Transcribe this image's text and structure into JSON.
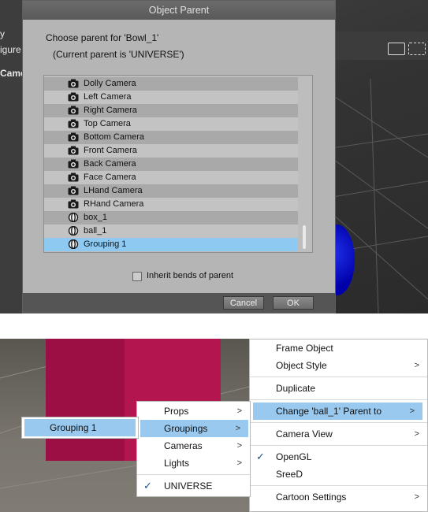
{
  "top_scene": {
    "left_labels": [
      "y",
      "igure",
      "Came"
    ]
  },
  "dialog": {
    "title": "Object Parent",
    "prompt": "Choose parent for 'Bowl_1'",
    "current_parent": "(Current parent is 'UNIVERSE')",
    "items": [
      {
        "label": "Dolly Camera",
        "icon": "camera-icon",
        "selected": false
      },
      {
        "label": "Left Camera",
        "icon": "camera-icon",
        "selected": false
      },
      {
        "label": "Right Camera",
        "icon": "camera-icon",
        "selected": false
      },
      {
        "label": "Top Camera",
        "icon": "camera-icon",
        "selected": false
      },
      {
        "label": "Bottom Camera",
        "icon": "camera-icon",
        "selected": false
      },
      {
        "label": "Front Camera",
        "icon": "camera-icon",
        "selected": false
      },
      {
        "label": "Back Camera",
        "icon": "camera-icon",
        "selected": false
      },
      {
        "label": "Face Camera",
        "icon": "camera-icon",
        "selected": false
      },
      {
        "label": "LHand Camera",
        "icon": "camera-icon",
        "selected": false
      },
      {
        "label": "RHand Camera",
        "icon": "camera-icon",
        "selected": false
      },
      {
        "label": "box_1",
        "icon": "prop-icon",
        "selected": false
      },
      {
        "label": "ball_1",
        "icon": "prop-icon",
        "selected": false
      },
      {
        "label": "Grouping 1",
        "icon": "prop-icon",
        "selected": true
      }
    ],
    "inherit_label": "Inherit bends of parent",
    "inherit_checked": false,
    "cancel_label": "Cancel",
    "ok_label": "OK"
  },
  "context_menu": {
    "main": [
      {
        "label": "Frame Object",
        "submenu": false
      },
      {
        "label": "Object Style",
        "submenu": true
      },
      {
        "label": "Duplicate",
        "submenu": false
      },
      {
        "label": "Change 'ball_1' Parent to",
        "submenu": true,
        "highlighted": true
      },
      {
        "label": "Camera View",
        "submenu": true
      },
      {
        "label": "OpenGL",
        "submenu": false,
        "checked": true
      },
      {
        "label": "SreeD",
        "submenu": false
      },
      {
        "label": "Cartoon Settings",
        "submenu": true
      }
    ],
    "parent_menu": [
      {
        "label": "Props",
        "submenu": true
      },
      {
        "label": "Groupings",
        "submenu": true,
        "highlighted": true
      },
      {
        "label": "Cameras",
        "submenu": true
      },
      {
        "label": "Lights",
        "submenu": true
      },
      {
        "label": "UNIVERSE",
        "submenu": false,
        "checked": true
      }
    ],
    "groupings_menu": [
      {
        "label": "Grouping 1",
        "highlighted": true
      }
    ],
    "arrow_glyph": ">",
    "check_glyph": "✓"
  },
  "colors": {
    "highlight": "#99c9ef",
    "list_selected": "#8ec9f2",
    "box": "#b3154f",
    "ball": "#0000cc"
  }
}
